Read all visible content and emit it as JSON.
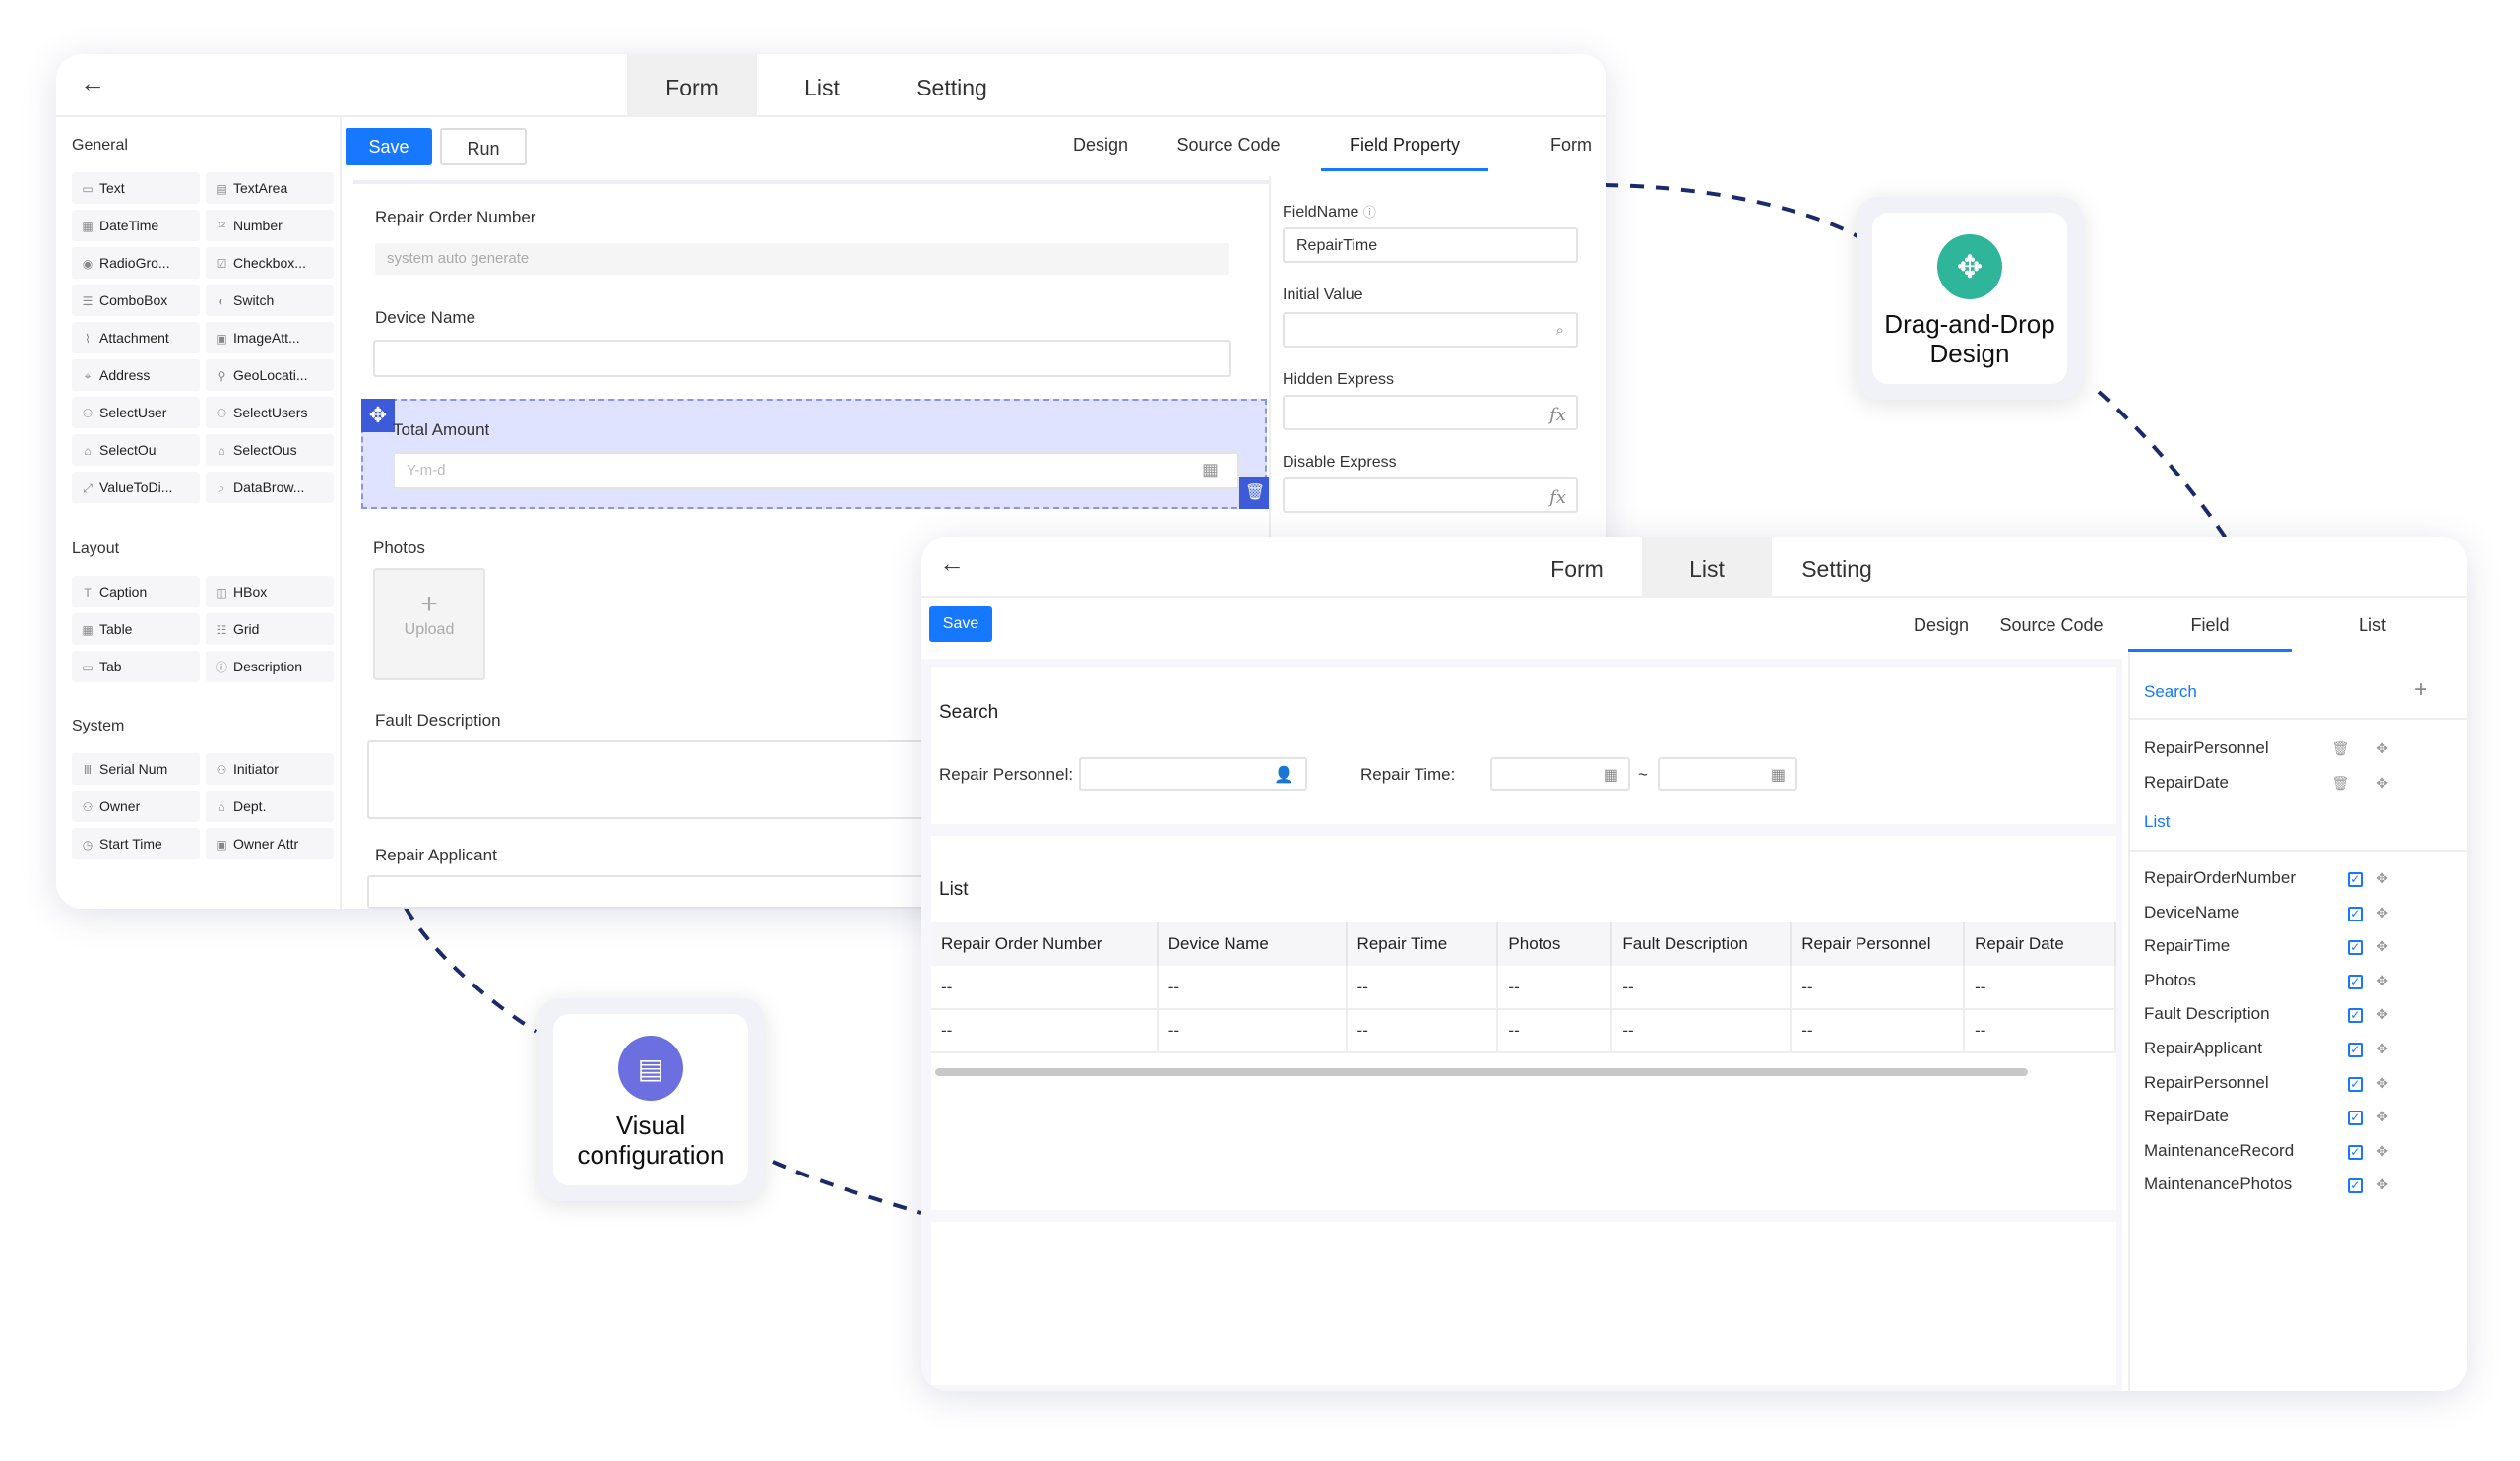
{
  "designer": {
    "tabs": [
      "Form",
      "List",
      "Setting"
    ],
    "active_tab": "Form",
    "buttons": {
      "save": "Save",
      "run": "Run"
    },
    "subtabs": [
      "Design",
      "Source Code",
      "Field Property",
      "Form"
    ],
    "active_subtab": "Field Property",
    "palette": {
      "general_title": "General",
      "general": [
        {
          "label": "Text",
          "icon": "text-icon"
        },
        {
          "label": "TextArea",
          "icon": "textarea-icon"
        },
        {
          "label": "DateTime",
          "icon": "datetime-icon"
        },
        {
          "label": "Number",
          "icon": "number-icon"
        },
        {
          "label": "RadioGro...",
          "icon": "radio-icon"
        },
        {
          "label": "Checkbox...",
          "icon": "checkbox-icon"
        },
        {
          "label": "ComboBox",
          "icon": "combobox-icon"
        },
        {
          "label": "Switch",
          "icon": "switch-icon"
        },
        {
          "label": "Attachment",
          "icon": "attachment-icon"
        },
        {
          "label": "ImageAtt...",
          "icon": "image-icon"
        },
        {
          "label": "Address",
          "icon": "location-icon"
        },
        {
          "label": "GeoLocati...",
          "icon": "geo-icon"
        },
        {
          "label": "SelectUser",
          "icon": "user-icon"
        },
        {
          "label": "SelectUsers",
          "icon": "users-icon"
        },
        {
          "label": "SelectOu",
          "icon": "org-icon"
        },
        {
          "label": "SelectOus",
          "icon": "orgs-icon"
        },
        {
          "label": "ValueToDi...",
          "icon": "value-icon"
        },
        {
          "label": "DataBrow...",
          "icon": "search-icon"
        }
      ],
      "layout_title": "Layout",
      "layout": [
        {
          "label": "Caption",
          "icon": "caption-icon"
        },
        {
          "label": "HBox",
          "icon": "hbox-icon"
        },
        {
          "label": "Table",
          "icon": "table-icon"
        },
        {
          "label": "Grid",
          "icon": "grid-icon"
        },
        {
          "label": "Tab",
          "icon": "tab-icon"
        },
        {
          "label": "Description",
          "icon": "info-icon"
        }
      ],
      "system_title": "System",
      "system": [
        {
          "label": "Serial Num",
          "icon": "serial-icon"
        },
        {
          "label": "Initiator",
          "icon": "user-icon"
        },
        {
          "label": "Owner",
          "icon": "user-icon"
        },
        {
          "label": "Dept.",
          "icon": "home-icon"
        },
        {
          "label": "Start Time",
          "icon": "clock-icon"
        },
        {
          "label": "Owner Attr",
          "icon": "attr-icon"
        }
      ]
    },
    "canvas": {
      "repair_order_label": "Repair Order Number",
      "repair_order_placeholder": "system auto generate",
      "device_name_label": "Device Name",
      "total_amount_label": "Total Amount",
      "date_placeholder": "Y-m-d",
      "photos_label": "Photos",
      "upload_label": "Upload",
      "fault_description_label": "Fault Description",
      "repair_applicant_label": "Repair Applicant"
    },
    "properties": {
      "field_name_label": "FieldName",
      "field_name_value": "RepairTime",
      "initial_value_label": "Initial Value",
      "hidden_express_label": "Hidden Express",
      "disable_express_label": "Disable Express",
      "fx": "fx"
    }
  },
  "list_designer": {
    "tabs": [
      "Form",
      "List",
      "Setting"
    ],
    "active_tab": "List",
    "save": "Save",
    "subtabs": [
      "Design",
      "Source Code",
      "Field",
      "List"
    ],
    "active_subtab": "Field",
    "search": {
      "title": "Search",
      "personnel_label": "Repair Personnel:",
      "time_label": "Repair Time:",
      "tilde": "~"
    },
    "list": {
      "title": "List",
      "columns": [
        "Repair Order Number",
        "Device Name",
        "Repair Time",
        "Photos",
        "Fault Description",
        "Repair Personnel",
        "Repair Date"
      ],
      "rows": [
        [
          "--",
          "--",
          "--",
          "--",
          "--",
          "--",
          "--"
        ],
        [
          "--",
          "--",
          "--",
          "--",
          "--",
          "--",
          "--"
        ]
      ]
    },
    "field_panel": {
      "search_title": "Search",
      "plus": "+",
      "search_fields": [
        "RepairPersonnel",
        "RepairDate"
      ],
      "list_title": "List",
      "list_fields": [
        "RepairOrderNumber",
        "DeviceName",
        "RepairTime",
        "Photos",
        "Fault Description",
        "RepairApplicant",
        "RepairPersonnel",
        "RepairDate",
        "MaintenanceRecord",
        "MaintenancePhotos"
      ]
    }
  },
  "badges": {
    "drag_drop": "Drag-and-Drop\nDesign",
    "visual": "Visual\nconfiguration"
  },
  "colors": {
    "primary": "#1677ff",
    "drag_badge": "#2fb59a",
    "visual_badge": "#6b6fe0",
    "selection": "#dfe3ff",
    "dashed_line": "#1b2a6b"
  }
}
